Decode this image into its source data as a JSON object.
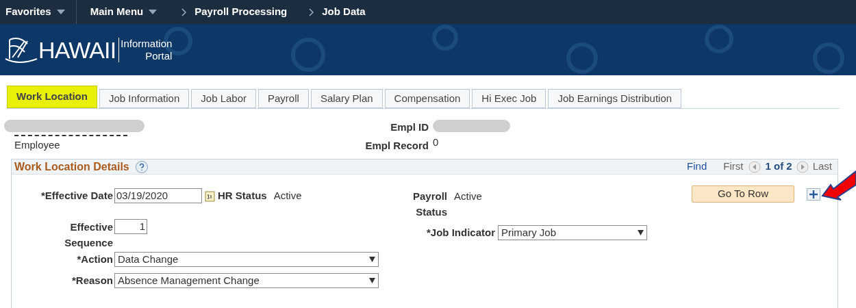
{
  "nav": {
    "items": [
      {
        "label": "Favorites",
        "kind": "menu"
      },
      {
        "label": "Main Menu",
        "kind": "menu"
      },
      {
        "label": "Payroll Processing",
        "kind": "crumb"
      },
      {
        "label": "Job Data",
        "kind": "crumb"
      }
    ]
  },
  "banner": {
    "logo_main": "HAWAII",
    "logo_sub_1": "Information",
    "logo_sub_2": "Portal"
  },
  "tabs": [
    {
      "label": "Work Location",
      "selected": true
    },
    {
      "label": "Job Information",
      "selected": false
    },
    {
      "label": "Job Labor",
      "selected": false
    },
    {
      "label": "Payroll",
      "selected": false
    },
    {
      "label": "Salary Plan",
      "selected": false
    },
    {
      "label": "Compensation",
      "selected": false
    },
    {
      "label": "Hi Exec Job",
      "selected": false
    },
    {
      "label": "Job Earnings Distribution",
      "selected": false
    }
  ],
  "employee": {
    "caption": "Employee",
    "empl_id_label": "Empl ID",
    "empl_record_label": "Empl Record",
    "empl_record": "0"
  },
  "section": {
    "title": "Work Location Details",
    "find": "Find",
    "first": "First",
    "count": "1 of 2",
    "last": "Last",
    "go_to_row": "Go To Row",
    "effective_date_label": "*Effective Date",
    "effective_date": "03/19/2020",
    "hr_status_label": "HR Status",
    "hr_status": "Active",
    "payroll_status_label": "Payroll Status",
    "payroll_status": "Active",
    "sequence_label": "Effective Sequence",
    "sequence": "1",
    "job_indicator_label": "*Job Indicator",
    "job_indicator": "Primary Job",
    "action_label": "*Action",
    "action": "Data Change",
    "reason_label": "*Reason",
    "reason": "Absence Management Change"
  }
}
